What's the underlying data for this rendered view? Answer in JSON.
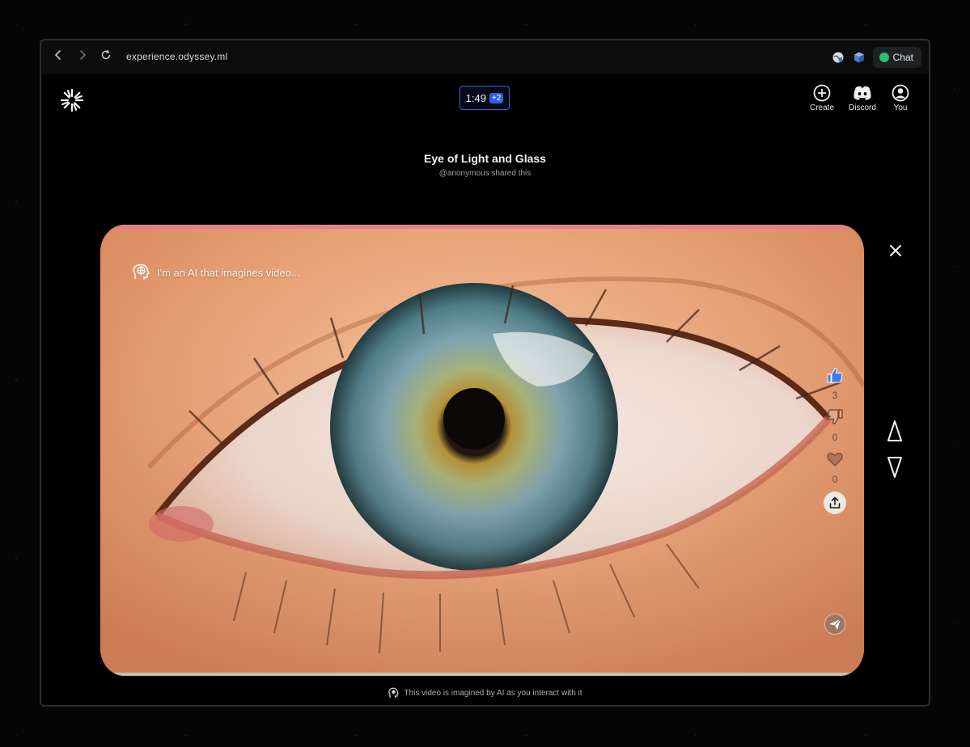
{
  "browser": {
    "url": "experience.odyssey.ml",
    "chat_label": "Chat"
  },
  "header": {
    "timer": "1:49",
    "timer_badge": "+2",
    "actions": [
      {
        "label": "Create",
        "icon": "plus-circle-icon"
      },
      {
        "label": "Discord",
        "icon": "discord-icon"
      },
      {
        "label": "You",
        "icon": "user-circle-icon"
      }
    ]
  },
  "video": {
    "title": "Eye of Light and Glass",
    "subtitle": "@anonymous shared this",
    "ai_caption": "I'm an AI that imagines video...",
    "likes": "3",
    "dislikes": "0",
    "hearts": "0"
  },
  "footer": {
    "note": "This video is imagined by AI as you interact with it"
  },
  "colors": {
    "accent": "#2b5fe0",
    "chat_dot": "#2bbf6a",
    "frame_top": "#e07a95"
  }
}
